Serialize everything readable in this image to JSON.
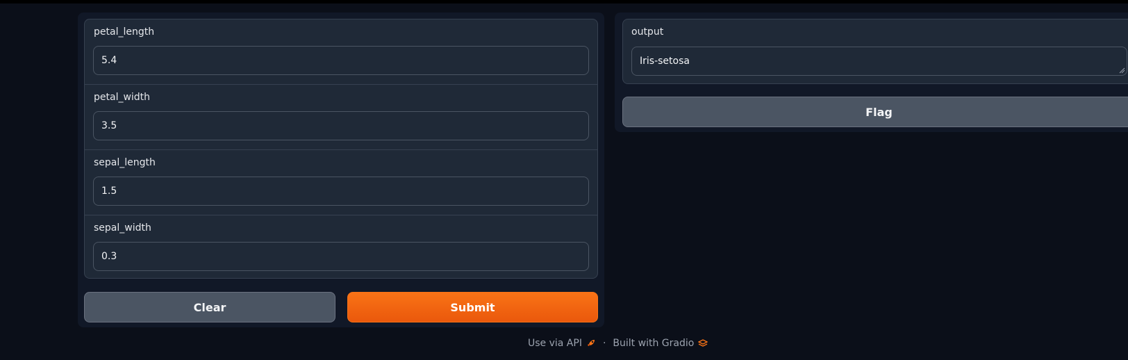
{
  "inputs": [
    {
      "label": "petal_length",
      "value": "5.4"
    },
    {
      "label": "petal_width",
      "value": "3.5"
    },
    {
      "label": "sepal_length",
      "value": "1.5"
    },
    {
      "label": "sepal_width",
      "value": "0.3"
    }
  ],
  "buttons": {
    "clear": "Clear",
    "submit": "Submit",
    "flag": "Flag"
  },
  "output": {
    "label": "output",
    "value": "Iris-setosa"
  },
  "footer": {
    "api": "Use via API",
    "separator": "·",
    "built": "Built with Gradio"
  },
  "colors": {
    "accent": "#ea580c",
    "background": "#0b0f19",
    "panel": "#1f2937"
  },
  "icons": {
    "api": "rocket-icon",
    "built": "gradio-logo-icon"
  }
}
